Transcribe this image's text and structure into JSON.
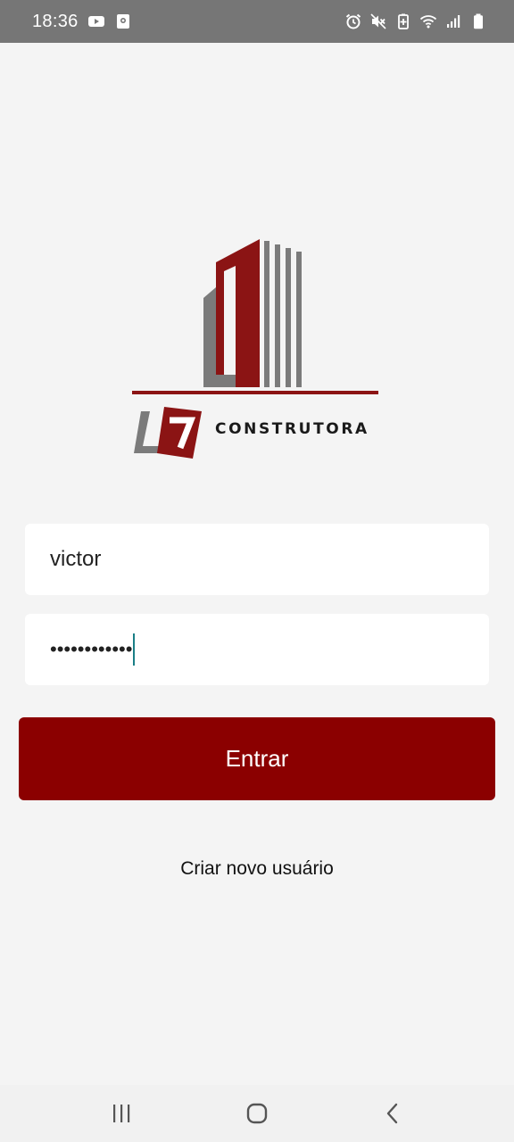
{
  "status_bar": {
    "time": "18:36",
    "left_icons": [
      "youtube-icon",
      "screenshot-icon"
    ],
    "right_icons": [
      "alarm-icon",
      "mute-icon",
      "battery-saver-icon",
      "wifi-icon",
      "signal-icon",
      "battery-icon"
    ]
  },
  "logo": {
    "mark": "L7",
    "brand": "CONSTRUTORA",
    "colors": {
      "red": "#8b1414",
      "gray": "#7b7b7b",
      "dark": "#1a1a1a"
    }
  },
  "login": {
    "username_value": "victor",
    "password_masked": "••••••••••••",
    "submit_label": "Entrar",
    "create_user_label": "Criar novo usuário"
  },
  "theme": {
    "accent": "#8b0000",
    "background": "#f4f4f4",
    "status_bar": "#767676"
  },
  "nav_bar": {
    "buttons": [
      "recent-apps",
      "home",
      "back"
    ]
  }
}
